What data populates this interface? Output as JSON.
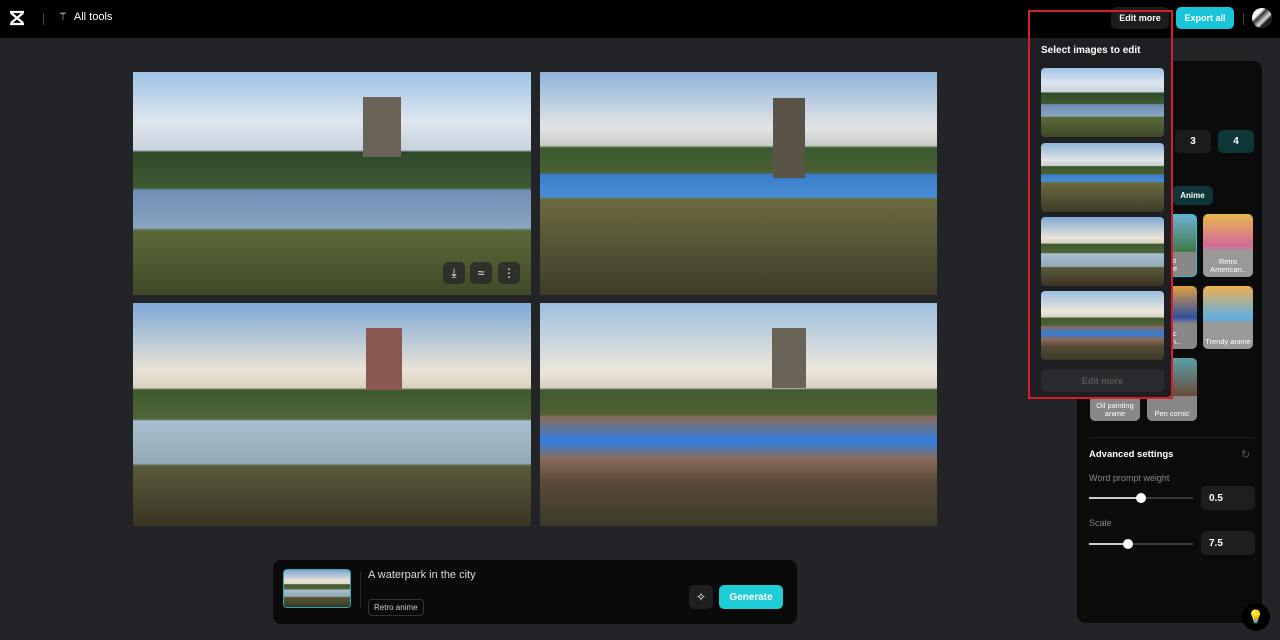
{
  "header": {
    "all_tools": "All tools",
    "edit_more": "Edit more",
    "export_all": "Export all"
  },
  "prompt": {
    "text": "A waterpark in the city",
    "style_tag": "Retro anime",
    "generate": "Generate"
  },
  "popup": {
    "title": "Select images to edit",
    "edit_more": "Edit more"
  },
  "panel": {
    "counts": [
      "3",
      "4"
    ],
    "selected_count": "4",
    "category": "Anime",
    "styles": [
      {
        "label": "tro\nme"
      },
      {
        "label": "Retro American.."
      },
      {
        "label": "sic\ncan.."
      },
      {
        "label": "Trendy anime"
      },
      {
        "label": "Oil painting anime"
      },
      {
        "label": "Pen comic"
      }
    ],
    "advanced": {
      "title": "Advanced settings",
      "word_weight": {
        "label": "Word prompt weight",
        "value": "0.5",
        "fraction": 0.5
      },
      "scale": {
        "label": "Scale",
        "value": "7.5",
        "fraction": 0.37
      }
    }
  },
  "colors": {
    "accent": "#19c5d8",
    "highlight_border": "#d4202a"
  }
}
